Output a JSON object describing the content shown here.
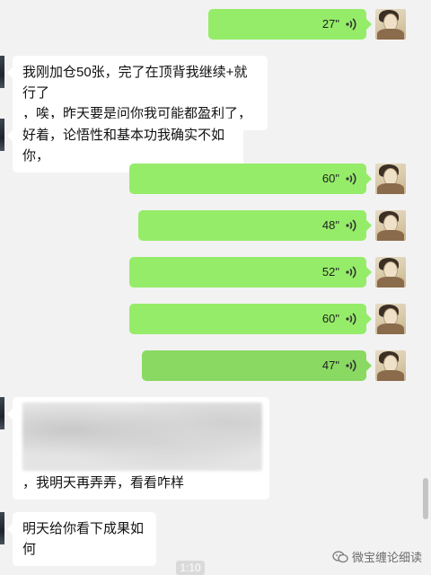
{
  "messages": [
    {
      "side": "right",
      "type": "voice",
      "duration": "27\""
    },
    {
      "side": "left",
      "type": "text",
      "lines": [
        "我刚加仓50张，完了在顶背我继续+就行了",
        "，唉，昨天要是问你我可能都盈利了，"
      ]
    },
    {
      "side": "left",
      "type": "text",
      "lines": [
        "好着，论悟性和基本功我确实不如你，"
      ]
    },
    {
      "side": "right",
      "type": "voice",
      "duration": "60\""
    },
    {
      "side": "right",
      "type": "voice",
      "duration": "48\""
    },
    {
      "side": "right",
      "type": "voice",
      "duration": "52\""
    },
    {
      "side": "right",
      "type": "voice",
      "duration": "60\""
    },
    {
      "side": "right",
      "type": "voice",
      "duration": "47\""
    },
    {
      "side": "left",
      "type": "text",
      "lines": [
        "，我明天再弄弄，看看咋样"
      ],
      "has_blurred_image": true
    },
    {
      "side": "left",
      "type": "text",
      "lines": [
        "明天给你看下成果如何"
      ]
    }
  ],
  "timestamp": "1:10",
  "watermark": "微宝缠论细读",
  "icons": {
    "voice_wave": "voice-wave-icon",
    "watermark": "wechat-official-account-icon"
  },
  "colors": {
    "background": "#f2f2f2",
    "outgoing_bubble": "#95ec69",
    "incoming_bubble": "#ffffff"
  }
}
